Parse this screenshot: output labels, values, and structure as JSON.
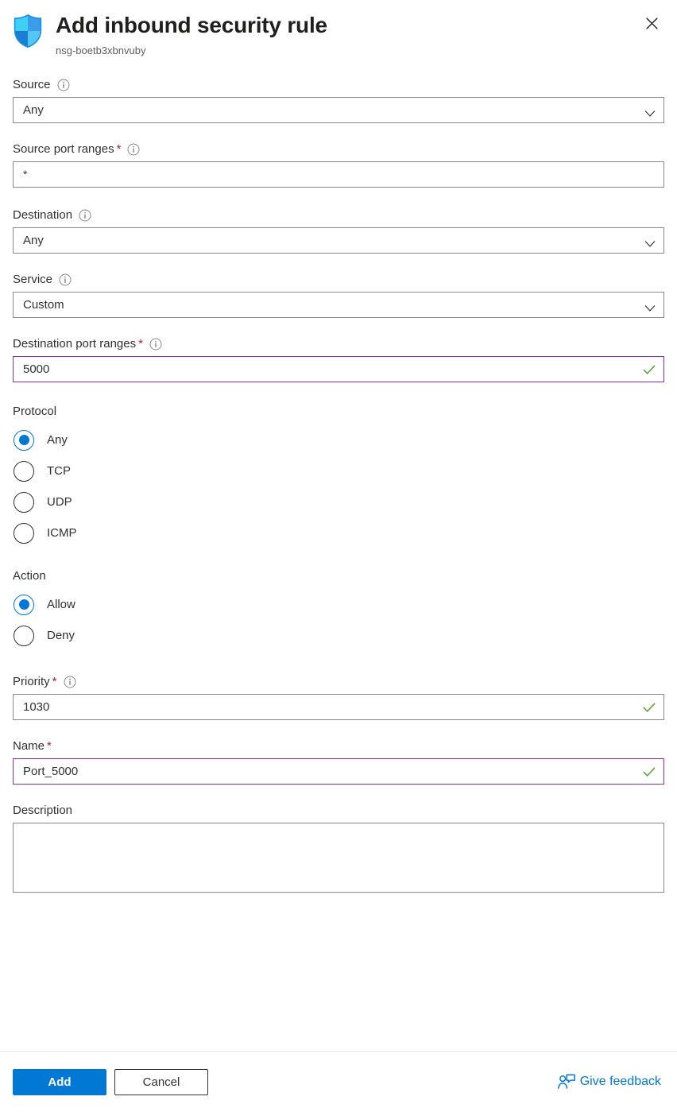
{
  "header": {
    "icon": "shield-icon",
    "title": "Add inbound security rule",
    "subtitle": "nsg-boetb3xbnvuby",
    "close_icon": "close-icon"
  },
  "colors": {
    "accent": "#0078d4",
    "required_star": "#a4262c",
    "focus_border": "#8b2fb0",
    "valid_check": "#5ca33b",
    "field_border": "#8a8886",
    "label_text": "#323130",
    "subtitle_text": "#605e5c"
  },
  "form": {
    "source": {
      "label": "Source",
      "required": false,
      "info_icon": "info-icon",
      "value": "Any",
      "control": "dropdown",
      "chevron_icon": "chevron-down-icon"
    },
    "source_port_ranges": {
      "label": "Source port ranges",
      "required": true,
      "star": "*",
      "info_icon": "info-icon",
      "value": "*",
      "control": "textbox"
    },
    "destination": {
      "label": "Destination",
      "required": false,
      "info_icon": "info-icon",
      "value": "Any",
      "control": "dropdown",
      "chevron_icon": "chevron-down-icon"
    },
    "service": {
      "label": "Service",
      "required": false,
      "info_icon": "info-icon",
      "value": "Custom",
      "control": "dropdown",
      "chevron_icon": "chevron-down-icon"
    },
    "destination_port_ranges": {
      "label": "Destination port ranges",
      "required": true,
      "star": "*",
      "info_icon": "info-icon",
      "value": "5000",
      "control": "textbox",
      "state": "focused-valid",
      "validation_icon": "checkmark-icon"
    },
    "protocol": {
      "label": "Protocol",
      "selected": "Any",
      "options": [
        {
          "label": "Any",
          "selected": true
        },
        {
          "label": "TCP",
          "selected": false
        },
        {
          "label": "UDP",
          "selected": false
        },
        {
          "label": "ICMP",
          "selected": false
        }
      ]
    },
    "action": {
      "label": "Action",
      "selected": "Allow",
      "options": [
        {
          "label": "Allow",
          "selected": true
        },
        {
          "label": "Deny",
          "selected": false
        }
      ]
    },
    "priority": {
      "label": "Priority",
      "required": true,
      "star": "*",
      "info_icon": "info-icon",
      "value": "1030",
      "control": "textbox",
      "validation_icon": "checkmark-icon"
    },
    "name": {
      "label": "Name",
      "required": true,
      "star": "*",
      "value": "Port_5000",
      "control": "textbox",
      "state": "focused-valid",
      "validation_icon": "checkmark-icon"
    },
    "description": {
      "label": "Description",
      "required": false,
      "value": "",
      "placeholder": "",
      "control": "textarea"
    }
  },
  "footer": {
    "add_label": "Add",
    "cancel_label": "Cancel",
    "feedback_label": "Give feedback",
    "feedback_icon": "feedback-person-icon"
  }
}
